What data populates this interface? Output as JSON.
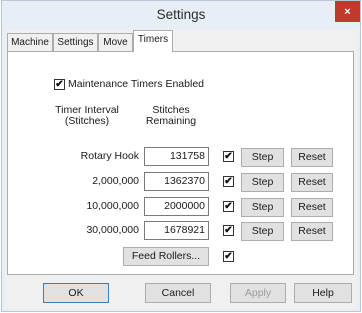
{
  "window": {
    "title": "Settings",
    "close_glyph": "×"
  },
  "tabs": [
    {
      "label": "Machine",
      "active": false
    },
    {
      "label": "Settings",
      "active": false
    },
    {
      "label": "Move",
      "active": false
    },
    {
      "label": "Timers",
      "active": true
    }
  ],
  "timers": {
    "enabled_label": "Maintenance Timers Enabled",
    "enabled_checked": true,
    "header_interval": "Timer Interval (Stitches)",
    "header_remaining": "Stitches Remaining",
    "rows": [
      {
        "label": "Rotary Hook",
        "value": "131758",
        "checked": true,
        "step": "Step",
        "reset": "Reset"
      },
      {
        "label": "2,000,000",
        "value": "1362370",
        "checked": true,
        "step": "Step",
        "reset": "Reset"
      },
      {
        "label": "10,000,000",
        "value": "2000000",
        "checked": true,
        "step": "Step",
        "reset": "Reset"
      },
      {
        "label": "30,000,000",
        "value": "1678921",
        "checked": true,
        "step": "Step",
        "reset": "Reset"
      }
    ],
    "feed_rollers_label": "Feed Rollers...",
    "feed_rollers_checked": true
  },
  "footer": {
    "ok": "OK",
    "cancel": "Cancel",
    "apply": "Apply",
    "help": "Help"
  },
  "check_glyph": "✔"
}
